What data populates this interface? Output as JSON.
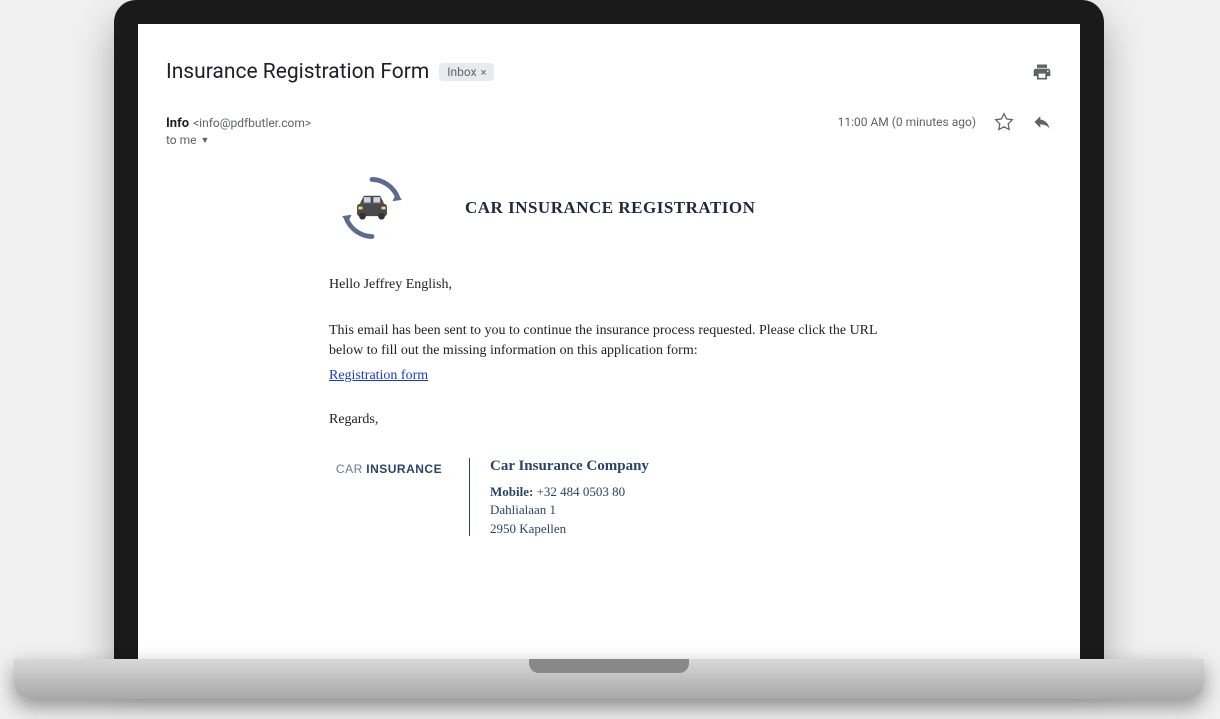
{
  "subject": "Insurance Registration Form",
  "inbox_label": "Inbox",
  "sender": {
    "name": "Info",
    "email": "<info@pdfbutler.com>",
    "to": "to me"
  },
  "timestamp": "11:00 AM (0 minutes ago)",
  "body": {
    "brand_title": "CAR INSURANCE REGISTRATION",
    "greeting": "Hello Jeffrey English,",
    "intro": "This email has been sent to you to continue the insurance process requested. Please click the URL below to fill out the missing information on this application form:",
    "link_text": "Registration form",
    "regards": "Regards,"
  },
  "signature": {
    "logo_text1": "CAR",
    "logo_text2": "INSURANCE",
    "company": "Car Insurance Company",
    "mobile_label": "Mobile:",
    "mobile": " +32 484 0503 80",
    "address1": "Dahlialaan 1",
    "address2": "2950 Kapellen"
  }
}
